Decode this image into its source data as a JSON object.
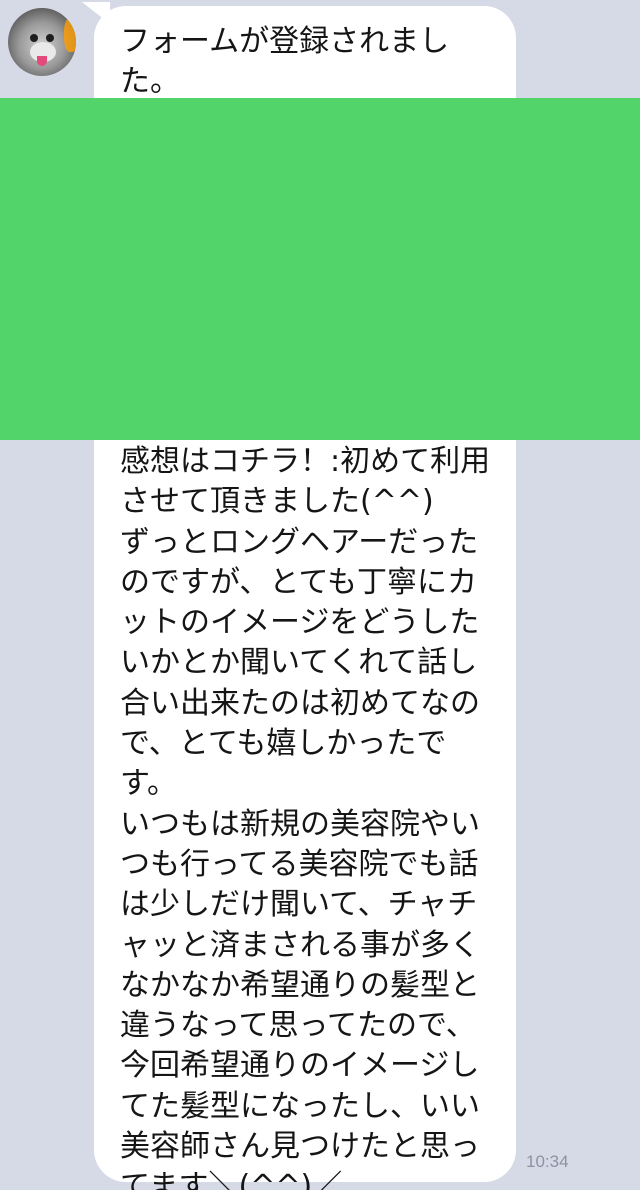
{
  "sender": {
    "avatar_icon": "dog-avatar-icon"
  },
  "message": {
    "top_text": "フォームが登録されまし\nた。",
    "body_text": "感想はコチラ！:初めて利用\nさせて頂きました(^^)\nずっとロングヘアーだった\nのですが、とても丁寧にカ\nットのイメージをどうした\nいかとか聞いてくれて話し\n合い出来たのは初めてなの\nで、とても嬉しかったで\nす。\nいつもは新規の美容院やい\nつも行ってる美容院でも話\nは少しだけ聞いて、チャチ\nャッと済まされる事が多く\nなかなか希望通りの髪型と\n違うなって思ってたので、\n今回希望通りのイメージし\nてた髪型になったし、いい\n美容師さん見つけたと思っ\nてます＼(^^)／",
    "time": "10:34"
  },
  "colors": {
    "chat_background": "#d5dae6",
    "bubble": "#ffffff",
    "redaction": "#52d46b",
    "timestamp": "#8b93a3"
  }
}
